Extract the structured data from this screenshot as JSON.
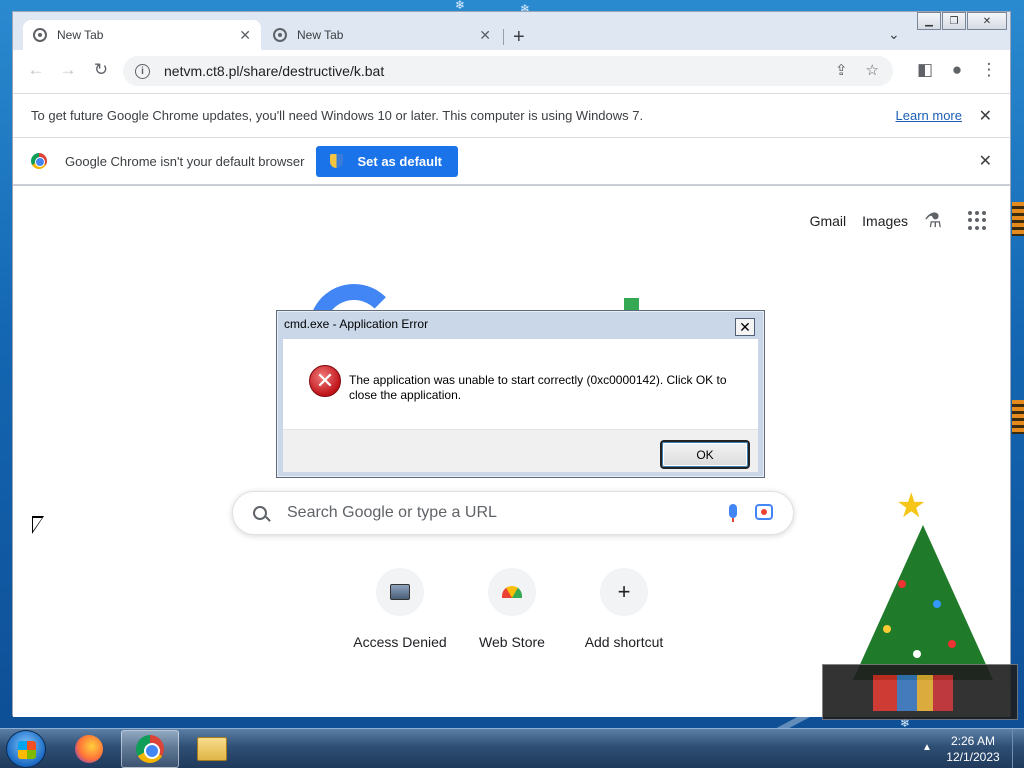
{
  "chrome": {
    "tabs": [
      {
        "title": "New Tab",
        "active": true
      },
      {
        "title": "New Tab",
        "active": false
      }
    ],
    "new_tab_icon": "plus-icon",
    "tab_search_icon": "chevron-down-icon",
    "window_controls": {
      "minimize": "minimize-icon",
      "maximize": "maximize-icon",
      "close": "close-icon"
    },
    "url": "netvm.ct8.pl/share/destructive/k.bat",
    "toolbar_icons": [
      "back-icon",
      "forward-icon",
      "reload-icon",
      "share-icon",
      "star-icon",
      "side-panel-icon",
      "profile-icon",
      "menu-icon"
    ]
  },
  "infobars": {
    "update": {
      "message": "To get future Google Chrome updates, you'll need Windows 10 or later. This computer is using Windows 7.",
      "link": "Learn more"
    },
    "default_browser": {
      "message": "Google Chrome isn't your default browser",
      "button": "Set as default"
    }
  },
  "ntp": {
    "top_links": [
      "Gmail",
      "Images"
    ],
    "search_placeholder": "Search Google or type a URL",
    "shortcuts": [
      {
        "label": "Access Denied",
        "icon": "computer-icon"
      },
      {
        "label": "Web Store",
        "icon": "web-store-icon"
      },
      {
        "label": "Add shortcut",
        "icon": "plus-icon"
      }
    ]
  },
  "dialog": {
    "title": "cmd.exe - Application Error",
    "message": "The application was unable to start correctly (0xc0000142). Click OK to close the application.",
    "ok_label": "OK",
    "icon": "error-icon"
  },
  "taskbar": {
    "apps": [
      "firefox-icon",
      "chrome-icon",
      "file-explorer-icon"
    ],
    "time": "2:26 AM",
    "date": "12/1/2023"
  },
  "colors": {
    "accent": "#1a73e8",
    "taskbar": "#2f4f74",
    "desktop": "#1467b3",
    "error_red": "#c0141a"
  }
}
